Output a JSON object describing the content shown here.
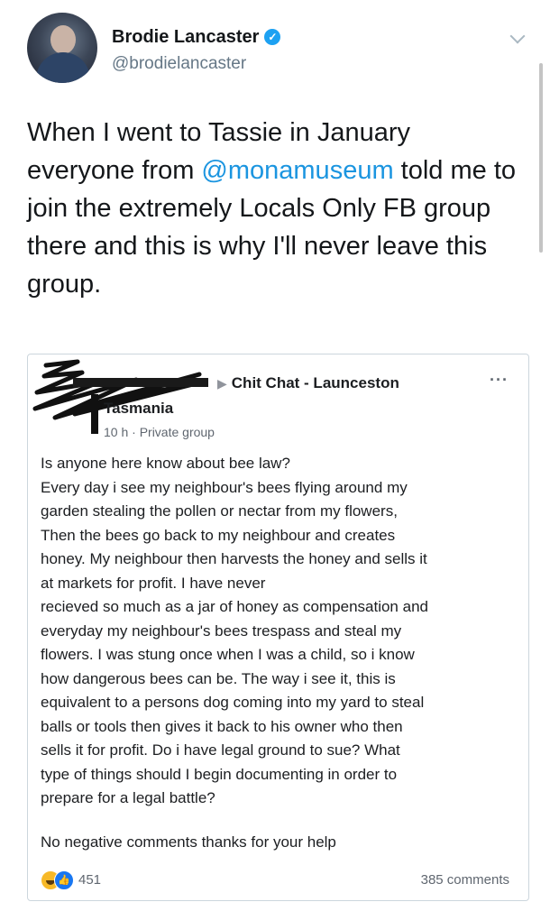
{
  "tweet": {
    "display_name": "Brodie Lancaster",
    "handle": "@brodielancaster",
    "verified_icon": "verified-badge-icon",
    "text_before": "When I went to Tassie in January everyone from ",
    "mention": "@monamuseum",
    "text_after": " told me to join the extremely Locals Only FB group there and this is why I'll never leave this group."
  },
  "fb_post": {
    "breadcrumb_arrow": "▶",
    "group_name": "Chit Chat - Launceston",
    "location": "Tasmania",
    "meta": "10 h · Private group",
    "more": "···",
    "body_lines": [
      "Is anyone here know about bee law?",
      "Every day i see my neighbour's bees flying around my",
      "garden stealing the pollen or nectar from my flowers,",
      "Then the bees go back to my neighbour and creates",
      "honey. My neighbour then harvests the honey and sells it",
      "at markets for profit. I have never",
      "recieved so much as a jar of honey as compensation and",
      "everyday my neighbour's bees trespass and steal my",
      "flowers. I was stung once when I was a child, so i know",
      "how dangerous bees can be. The way i see it, this is",
      "equivalent to a persons dog coming into my yard to steal",
      "balls or tools then gives it back to his owner who then",
      "sells it for profit. Do i have legal ground to sue? What",
      "type of things should I begin documenting in order to",
      "prepare for a legal battle?"
    ],
    "closing_line": "No negative comments thanks for your help",
    "reaction_count": "451",
    "comments_count": "385 comments"
  }
}
